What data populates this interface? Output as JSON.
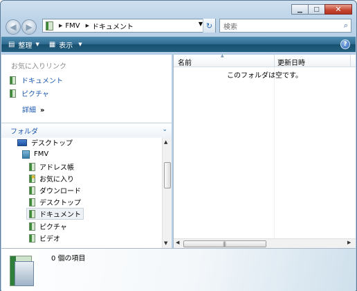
{
  "window": {
    "caption_buttons": [
      "minimize-icon",
      "maximize-icon",
      "close-icon"
    ]
  },
  "address_bar": {
    "crumbs": [
      "FMV",
      "ドキュメント"
    ]
  },
  "search": {
    "placeholder": "検索"
  },
  "toolbar": {
    "organize_label": "整理",
    "views_label": "表示",
    "help_label": "?"
  },
  "favorites": {
    "title": "お気に入りリンク",
    "items": [
      {
        "label": "ドキュメント",
        "icon": "documents-folder-icon"
      },
      {
        "label": "ピクチャ",
        "icon": "pictures-folder-icon"
      }
    ],
    "more_label": "詳細",
    "more_chevron": "»"
  },
  "folders": {
    "header": "フォルダ",
    "tree": [
      {
        "label": "デスクトップ",
        "icon": "desktop-icon"
      },
      {
        "label": "FMV",
        "icon": "user-folder-icon"
      },
      {
        "label": "アドレス帳",
        "icon": "contacts-folder-icon"
      },
      {
        "label": "お気に入り",
        "icon": "favorites-folder-icon"
      },
      {
        "label": "ダウンロード",
        "icon": "downloads-folder-icon"
      },
      {
        "label": "デスクトップ",
        "icon": "desktop-folder-icon"
      },
      {
        "label": "ドキュメント",
        "icon": "documents-folder-icon",
        "selected": true
      },
      {
        "label": "ピクチャ",
        "icon": "pictures-folder-icon"
      },
      {
        "label": "ビデオ",
        "icon": "videos-folder-icon"
      }
    ]
  },
  "file_list": {
    "columns": [
      "名前",
      "更新日時"
    ],
    "empty_message": "このフォルダは空です。"
  },
  "status": {
    "item_count_text": "0 個の項目"
  }
}
